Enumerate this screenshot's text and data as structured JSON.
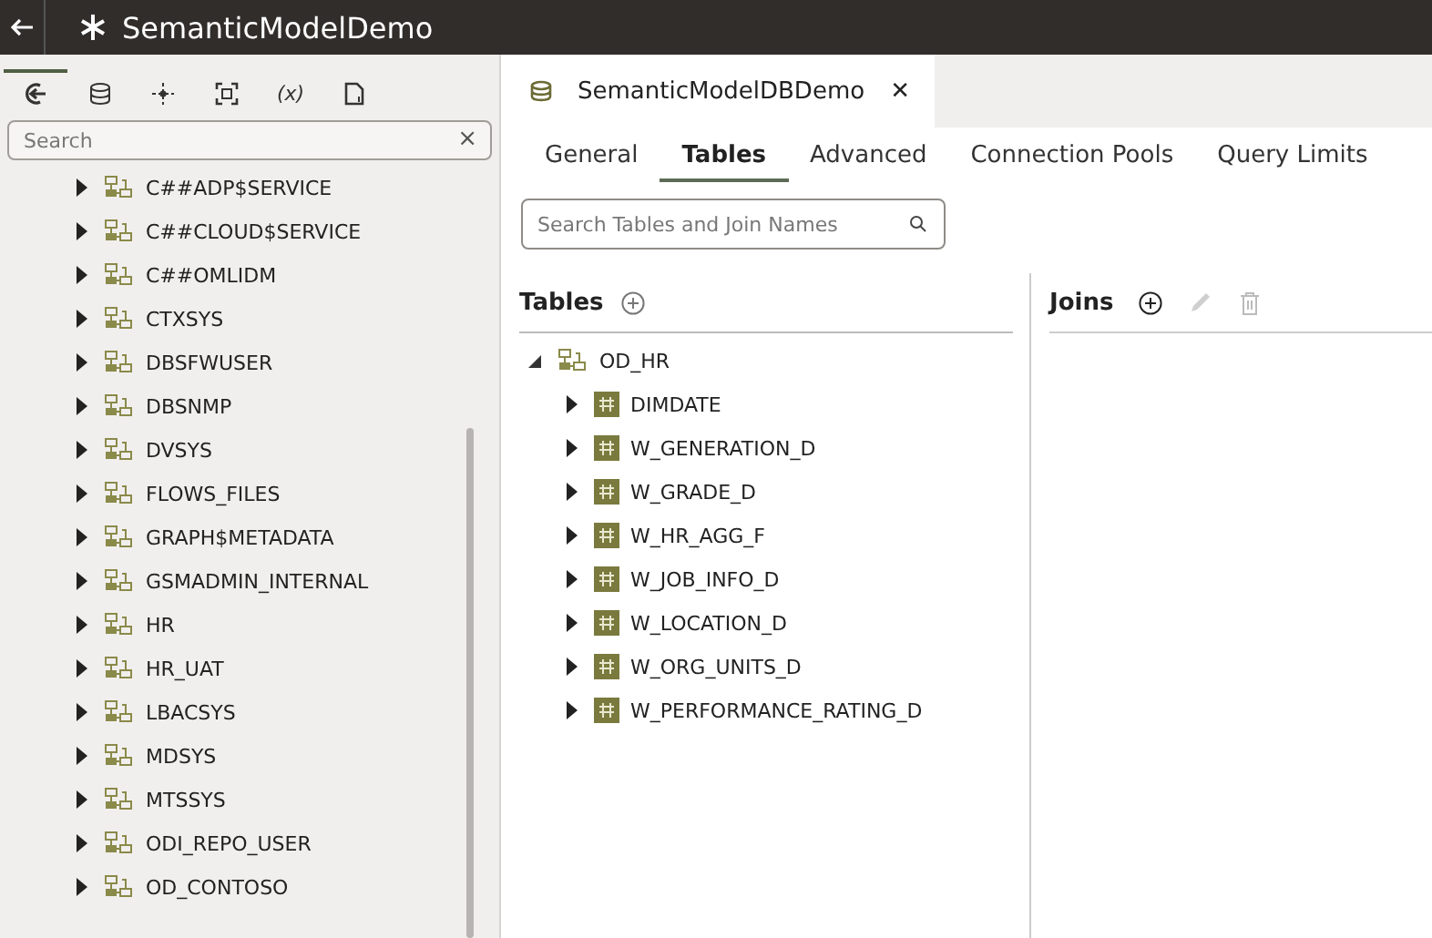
{
  "header": {
    "title": "SemanticModelDemo"
  },
  "sidebar": {
    "tool_tabs": [
      {
        "kind": "connect",
        "selected": true
      },
      {
        "kind": "database",
        "selected": false
      },
      {
        "kind": "move",
        "selected": false
      },
      {
        "kind": "frame",
        "selected": false
      },
      {
        "kind": "variable",
        "label": "(x)",
        "selected": false
      },
      {
        "kind": "document",
        "selected": false
      }
    ],
    "search": {
      "placeholder": "Search",
      "clear": "×"
    },
    "items": [
      {
        "label": "C##ADP$SERVICE",
        "expanded": false
      },
      {
        "label": "C##CLOUD$SERVICE",
        "expanded": false
      },
      {
        "label": "C##OMLIDM",
        "expanded": false
      },
      {
        "label": "CTXSYS",
        "expanded": false
      },
      {
        "label": "DBSFWUSER",
        "expanded": false
      },
      {
        "label": "DBSNMP",
        "expanded": false
      },
      {
        "label": "DVSYS",
        "expanded": false
      },
      {
        "label": "FLOWS_FILES",
        "expanded": false
      },
      {
        "label": "GRAPH$METADATA",
        "expanded": false
      },
      {
        "label": "GSMADMIN_INTERNAL",
        "expanded": false
      },
      {
        "label": "HR",
        "expanded": false
      },
      {
        "label": "HR_UAT",
        "expanded": false
      },
      {
        "label": "LBACSYS",
        "expanded": false
      },
      {
        "label": "MDSYS",
        "expanded": false
      },
      {
        "label": "MTSSYS",
        "expanded": false
      },
      {
        "label": "ODI_REPO_USER",
        "expanded": false
      },
      {
        "label": "OD_CONTOSO",
        "expanded": false
      }
    ]
  },
  "editor_tab": {
    "title": "SemanticModelDBDemo",
    "close": "✕"
  },
  "tabs": [
    {
      "label": "General",
      "selected": false
    },
    {
      "label": "Tables",
      "selected": true
    },
    {
      "label": "Advanced",
      "selected": false
    },
    {
      "label": "Connection Pools",
      "selected": false
    },
    {
      "label": "Query Limits",
      "selected": false
    }
  ],
  "table_search": {
    "placeholder": "Search Tables and Join Names"
  },
  "tables_panel": {
    "title": "Tables",
    "tree": [
      {
        "label": "OD_HR",
        "kind": "schema",
        "expanded": true,
        "children": [
          {
            "label": "DIMDATE",
            "kind": "table",
            "expanded": false
          },
          {
            "label": "W_GENERATION_D",
            "kind": "table",
            "expanded": false
          },
          {
            "label": "W_GRADE_D",
            "kind": "table",
            "expanded": false
          },
          {
            "label": "W_HR_AGG_F",
            "kind": "table",
            "expanded": false
          },
          {
            "label": "W_JOB_INFO_D",
            "kind": "table",
            "expanded": false
          },
          {
            "label": "W_LOCATION_D",
            "kind": "table",
            "expanded": false
          },
          {
            "label": "W_ORG_UNITS_D",
            "kind": "table",
            "expanded": false
          },
          {
            "label": "W_PERFORMANCE_RATING_D",
            "kind": "table",
            "expanded": false
          }
        ]
      }
    ]
  },
  "joins_panel": {
    "title": "Joins",
    "edit_disabled": true,
    "delete_disabled": true
  }
}
